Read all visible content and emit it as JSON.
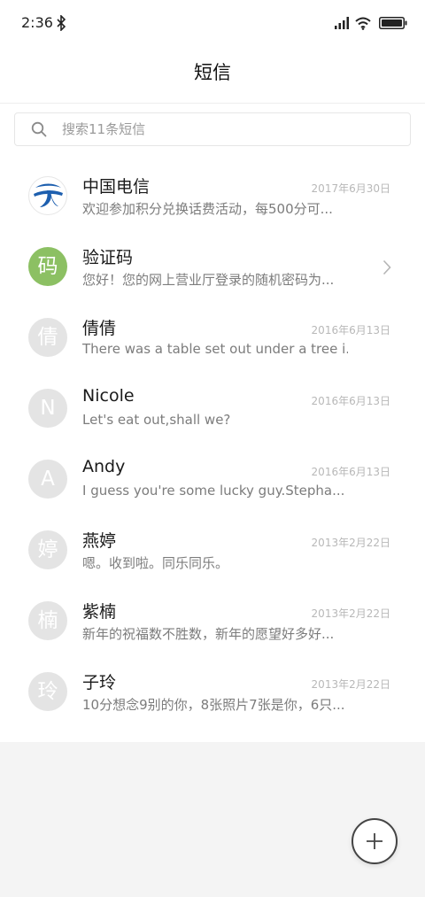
{
  "status_bar": {
    "time": "2:36",
    "icons": [
      "bluetooth-icon",
      "signal-icon",
      "wifi-icon",
      "battery-icon"
    ]
  },
  "header": {
    "title": "短信"
  },
  "search": {
    "placeholder": "搜索11条短信",
    "value": ""
  },
  "messages": [
    {
      "name": "中国电信",
      "preview": "欢迎参加积分兑换话费活动，每500分可...",
      "date": "2017年6月30日",
      "avatar": "china-telecom-logo"
    },
    {
      "name": "验证码",
      "preview": "您好！您的网上营业厅登录的随机密码为...",
      "avatar_text": "码",
      "avatar_color": "#8cc063"
    },
    {
      "name": "倩倩",
      "preview": "There was a table set out under a tree i...",
      "date": "2016年6月13日",
      "avatar_text": "倩"
    },
    {
      "name": "Nicole",
      "preview": "Let's eat out,shall we?",
      "date": "2016年6月13日",
      "avatar_text": "N"
    },
    {
      "name": "Andy",
      "preview": "I guess you're some lucky guy.Stepha...",
      "date": "2016年6月13日",
      "avatar_text": "A"
    },
    {
      "name": "燕婷",
      "preview": "嗯。收到啦。同乐同乐。",
      "date": "2013年2月22日",
      "avatar_text": "婷"
    },
    {
      "name": "紫楠",
      "preview": "新年的祝福数不胜数，新年的愿望好多好...",
      "date": "2013年2月22日",
      "avatar_text": "楠"
    },
    {
      "name": "子玲",
      "preview": "10分想念9别的你，8张照片7张是你，6只...",
      "date": "2013年2月22日",
      "avatar_text": "玲"
    }
  ],
  "colors": {
    "background": "#f4f4f4",
    "avatar_gray": "#e4e4e4",
    "avatar_green": "#8cc063",
    "telecom_blue": "#1d5faf"
  },
  "fab": {
    "icon": "plus-icon"
  }
}
